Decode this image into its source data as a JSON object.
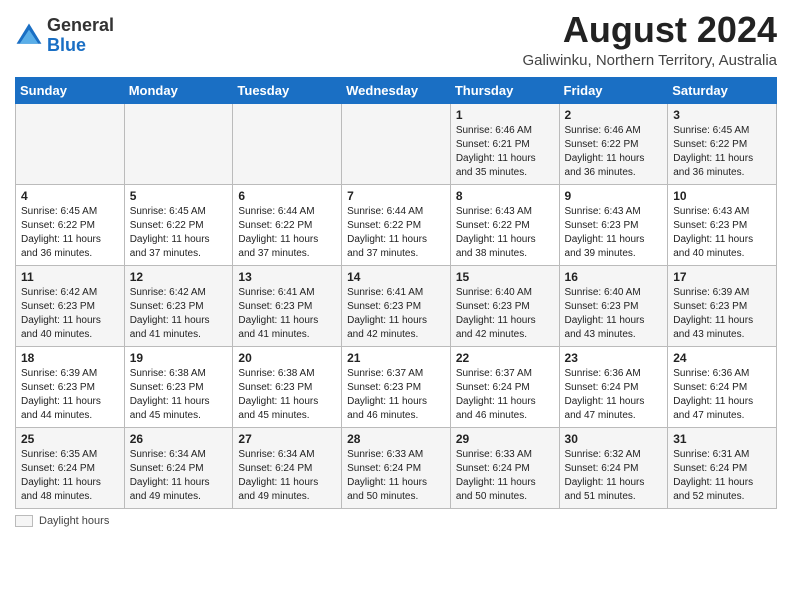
{
  "header": {
    "logo_general": "General",
    "logo_blue": "Blue",
    "month_title": "August 2024",
    "subtitle": "Galiwinku, Northern Territory, Australia"
  },
  "days_of_week": [
    "Sunday",
    "Monday",
    "Tuesday",
    "Wednesday",
    "Thursday",
    "Friday",
    "Saturday"
  ],
  "weeks": [
    [
      {
        "day": "",
        "info": ""
      },
      {
        "day": "",
        "info": ""
      },
      {
        "day": "",
        "info": ""
      },
      {
        "day": "",
        "info": ""
      },
      {
        "day": "1",
        "info": "Sunrise: 6:46 AM\nSunset: 6:21 PM\nDaylight: 11 hours\nand 35 minutes."
      },
      {
        "day": "2",
        "info": "Sunrise: 6:46 AM\nSunset: 6:22 PM\nDaylight: 11 hours\nand 36 minutes."
      },
      {
        "day": "3",
        "info": "Sunrise: 6:45 AM\nSunset: 6:22 PM\nDaylight: 11 hours\nand 36 minutes."
      }
    ],
    [
      {
        "day": "4",
        "info": "Sunrise: 6:45 AM\nSunset: 6:22 PM\nDaylight: 11 hours\nand 36 minutes."
      },
      {
        "day": "5",
        "info": "Sunrise: 6:45 AM\nSunset: 6:22 PM\nDaylight: 11 hours\nand 37 minutes."
      },
      {
        "day": "6",
        "info": "Sunrise: 6:44 AM\nSunset: 6:22 PM\nDaylight: 11 hours\nand 37 minutes."
      },
      {
        "day": "7",
        "info": "Sunrise: 6:44 AM\nSunset: 6:22 PM\nDaylight: 11 hours\nand 37 minutes."
      },
      {
        "day": "8",
        "info": "Sunrise: 6:43 AM\nSunset: 6:22 PM\nDaylight: 11 hours\nand 38 minutes."
      },
      {
        "day": "9",
        "info": "Sunrise: 6:43 AM\nSunset: 6:23 PM\nDaylight: 11 hours\nand 39 minutes."
      },
      {
        "day": "10",
        "info": "Sunrise: 6:43 AM\nSunset: 6:23 PM\nDaylight: 11 hours\nand 40 minutes."
      }
    ],
    [
      {
        "day": "11",
        "info": "Sunrise: 6:42 AM\nSunset: 6:23 PM\nDaylight: 11 hours\nand 40 minutes."
      },
      {
        "day": "12",
        "info": "Sunrise: 6:42 AM\nSunset: 6:23 PM\nDaylight: 11 hours\nand 41 minutes."
      },
      {
        "day": "13",
        "info": "Sunrise: 6:41 AM\nSunset: 6:23 PM\nDaylight: 11 hours\nand 41 minutes."
      },
      {
        "day": "14",
        "info": "Sunrise: 6:41 AM\nSunset: 6:23 PM\nDaylight: 11 hours\nand 42 minutes."
      },
      {
        "day": "15",
        "info": "Sunrise: 6:40 AM\nSunset: 6:23 PM\nDaylight: 11 hours\nand 42 minutes."
      },
      {
        "day": "16",
        "info": "Sunrise: 6:40 AM\nSunset: 6:23 PM\nDaylight: 11 hours\nand 43 minutes."
      },
      {
        "day": "17",
        "info": "Sunrise: 6:39 AM\nSunset: 6:23 PM\nDaylight: 11 hours\nand 43 minutes."
      }
    ],
    [
      {
        "day": "18",
        "info": "Sunrise: 6:39 AM\nSunset: 6:23 PM\nDaylight: 11 hours\nand 44 minutes."
      },
      {
        "day": "19",
        "info": "Sunrise: 6:38 AM\nSunset: 6:23 PM\nDaylight: 11 hours\nand 45 minutes."
      },
      {
        "day": "20",
        "info": "Sunrise: 6:38 AM\nSunset: 6:23 PM\nDaylight: 11 hours\nand 45 minutes."
      },
      {
        "day": "21",
        "info": "Sunrise: 6:37 AM\nSunset: 6:23 PM\nDaylight: 11 hours\nand 46 minutes."
      },
      {
        "day": "22",
        "info": "Sunrise: 6:37 AM\nSunset: 6:24 PM\nDaylight: 11 hours\nand 46 minutes."
      },
      {
        "day": "23",
        "info": "Sunrise: 6:36 AM\nSunset: 6:24 PM\nDaylight: 11 hours\nand 47 minutes."
      },
      {
        "day": "24",
        "info": "Sunrise: 6:36 AM\nSunset: 6:24 PM\nDaylight: 11 hours\nand 47 minutes."
      }
    ],
    [
      {
        "day": "25",
        "info": "Sunrise: 6:35 AM\nSunset: 6:24 PM\nDaylight: 11 hours\nand 48 minutes."
      },
      {
        "day": "26",
        "info": "Sunrise: 6:34 AM\nSunset: 6:24 PM\nDaylight: 11 hours\nand 49 minutes."
      },
      {
        "day": "27",
        "info": "Sunrise: 6:34 AM\nSunset: 6:24 PM\nDaylight: 11 hours\nand 49 minutes."
      },
      {
        "day": "28",
        "info": "Sunrise: 6:33 AM\nSunset: 6:24 PM\nDaylight: 11 hours\nand 50 minutes."
      },
      {
        "day": "29",
        "info": "Sunrise: 6:33 AM\nSunset: 6:24 PM\nDaylight: 11 hours\nand 50 minutes."
      },
      {
        "day": "30",
        "info": "Sunrise: 6:32 AM\nSunset: 6:24 PM\nDaylight: 11 hours\nand 51 minutes."
      },
      {
        "day": "31",
        "info": "Sunrise: 6:31 AM\nSunset: 6:24 PM\nDaylight: 11 hours\nand 52 minutes."
      }
    ]
  ],
  "footer": {
    "label": "Daylight hours"
  }
}
